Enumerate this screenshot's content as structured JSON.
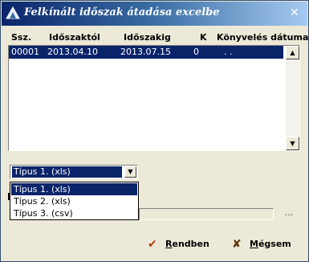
{
  "window": {
    "title": "Felkínált időszak átadása excelbe",
    "close_glyph": "✕"
  },
  "grid": {
    "columns": [
      "Ssz.",
      "Időszaktól",
      "Időszakig",
      "K",
      "Könyvelés dátuma"
    ],
    "rows": [
      {
        "ssz": "00001",
        "from": "2013.04.10",
        "to": "2013.07.15",
        "k": "0",
        "date": ". ."
      }
    ],
    "scroll_up": "▲",
    "scroll_down": "▼"
  },
  "export_type": {
    "selected": "Típus 1. (xls)",
    "arrow": "▼",
    "options": [
      "Típus 1. (xls)",
      "Típus 2. (xls)",
      "Típus 3. (csv)"
    ]
  },
  "path": {
    "browse_label": "..."
  },
  "buttons": {
    "ok_label": "Rendben",
    "ok_mnemonic": "R",
    "ok_rest": "endben",
    "ok_icon": "checkmark-icon",
    "cancel_label": "Mégsem",
    "cancel_mnemonic": "M",
    "cancel_rest": "égsem",
    "cancel_icon": "x-icon"
  },
  "colors": {
    "selection": "#0a246a",
    "title_gradient_start": "#0a246a",
    "title_gradient_end": "#a6caf0",
    "dialog_bg": "#ece9d8"
  }
}
